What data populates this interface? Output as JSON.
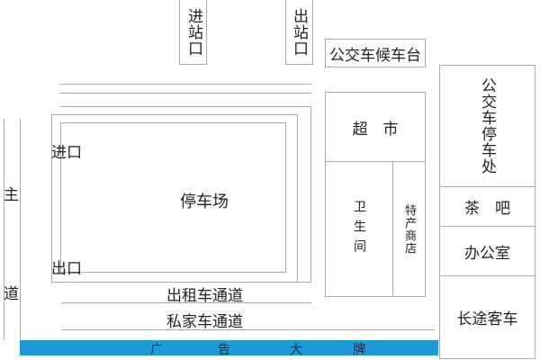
{
  "colors": {
    "line": "#aaaaaa",
    "billboard": "#1b9ad6",
    "text": "#222222"
  },
  "entrance_station": "进站口",
  "exit_station": "出站口",
  "bus_waiting_platform": "公交车候车台",
  "main_road": "主道",
  "parking_lot": {
    "title": "停车场",
    "entrance": "进口",
    "exit": "出口"
  },
  "taxi_lane": "出租车通道",
  "private_car_lane": "私家车通道",
  "billboard": [
    "广",
    "告",
    "大",
    "牌"
  ],
  "supermarket": "超　市",
  "toilet": "卫生间",
  "specialty_store": "特产商店",
  "bus_parking": "公交车停车处",
  "tea_bar": "茶　吧",
  "office": "办公室",
  "long_distance_bus": "长途客车"
}
